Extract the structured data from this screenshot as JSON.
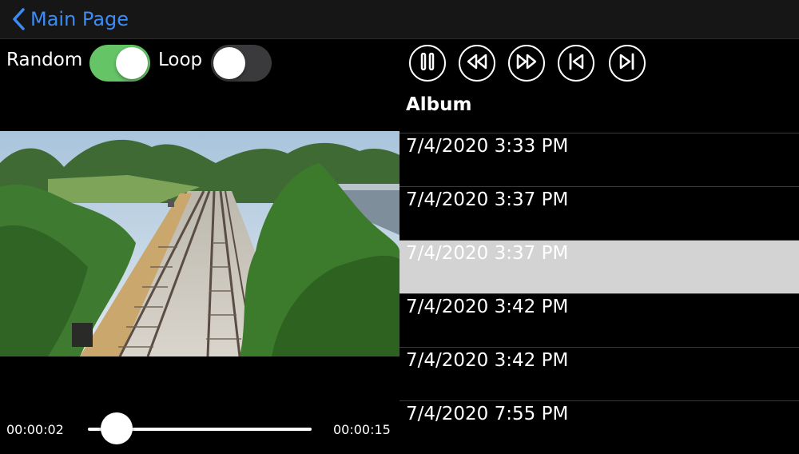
{
  "nav": {
    "back_label": "Main Page",
    "back_icon": "chevron-left-icon",
    "accent": "#3b8cf5"
  },
  "toggles": {
    "random": {
      "label": "Random",
      "on": true,
      "color_on": "#65c466"
    },
    "loop": {
      "label": "Loop",
      "on": false
    }
  },
  "controls": [
    "pause-icon",
    "rewind-icon",
    "fast-forward-icon",
    "skip-back-icon",
    "skip-forward-icon"
  ],
  "album": {
    "title": "Album",
    "items": [
      "7/4/2020 3:33 PM",
      "7/4/2020 3:37 PM",
      "7/4/2020 3:37 PM",
      "7/4/2020 3:42 PM",
      "7/4/2020 3:42 PM",
      "7/4/2020 7:55 PM"
    ],
    "selected_index": 2
  },
  "player": {
    "current_time": "00:00:02",
    "total_time": "00:00:15",
    "progress": 0.13
  }
}
